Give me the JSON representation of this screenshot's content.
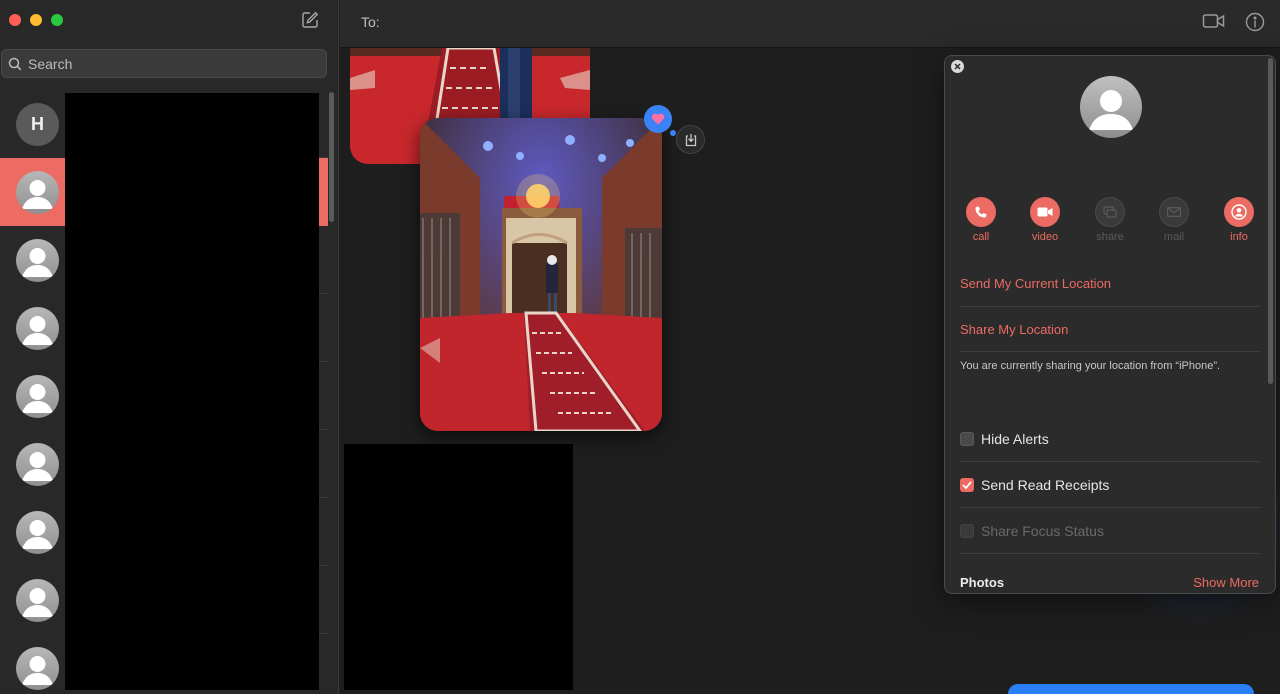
{
  "window": {
    "controls": [
      "close",
      "minimize",
      "zoom"
    ]
  },
  "sidebar": {
    "compose_icon": "compose-icon",
    "search": {
      "placeholder": "Search"
    },
    "conversations": [
      {
        "avatar": "initial",
        "initial": "H",
        "selected": false
      },
      {
        "avatar": "generic-person",
        "selected": true
      },
      {
        "avatar": "generic-person",
        "selected": false
      },
      {
        "avatar": "generic-person",
        "selected": false
      },
      {
        "avatar": "generic-person",
        "selected": false
      },
      {
        "avatar": "generic-person",
        "selected": false
      },
      {
        "avatar": "generic-person",
        "selected": false
      },
      {
        "avatar": "generic-person",
        "selected": false
      },
      {
        "avatar": "generic-person",
        "selected": false
      }
    ]
  },
  "header": {
    "to_label": "To:",
    "icons": [
      "facetime-video-icon",
      "info-circle-icon"
    ]
  },
  "chat": {
    "reaction": "heart",
    "icons": [
      "save-to-downloads-icon"
    ]
  },
  "details": {
    "actions": [
      {
        "label": "call",
        "icon": "phone-icon",
        "enabled": true
      },
      {
        "label": "video",
        "icon": "video-icon",
        "enabled": true
      },
      {
        "label": "share",
        "icon": "screen-share-icon",
        "enabled": false
      },
      {
        "label": "mail",
        "icon": "mail-icon",
        "enabled": false
      },
      {
        "label": "info",
        "icon": "person-icon",
        "enabled": true
      }
    ],
    "send_location": "Send My Current Location",
    "share_location": "Share My Location",
    "sharing_note": "You are currently sharing your location from “iPhone”.",
    "options": [
      {
        "label": "Hide Alerts",
        "checked": false,
        "enabled": true
      },
      {
        "label": "Send Read Receipts",
        "checked": true,
        "enabled": true
      },
      {
        "label": "Share Focus Status",
        "checked": false,
        "enabled": false
      }
    ],
    "photos_title": "Photos",
    "show_more": "Show More"
  },
  "colors": {
    "accent": "#ec6b62",
    "imessage_blue": "#3b82f6",
    "sidebar_bg": "#282828",
    "window_bg": "#1e1e1e"
  }
}
